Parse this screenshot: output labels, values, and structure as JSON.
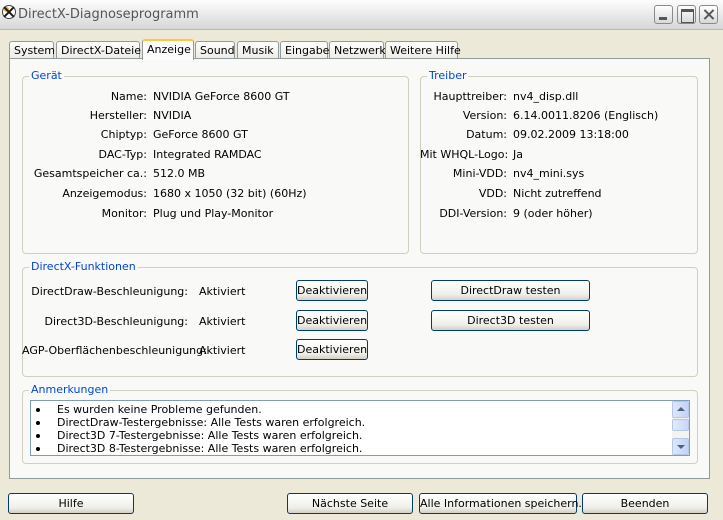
{
  "window": {
    "title": "DirectX-Diagnoseprogramm"
  },
  "tabs": [
    {
      "label": "System"
    },
    {
      "label": "DirectX-Dateien"
    },
    {
      "label": "Anzeige"
    },
    {
      "label": "Sound"
    },
    {
      "label": "Musik"
    },
    {
      "label": "Eingabe"
    },
    {
      "label": "Netzwerk"
    },
    {
      "label": "Weitere Hilfe"
    }
  ],
  "active_tab": "Anzeige",
  "device": {
    "title": "Gerät",
    "fields": [
      {
        "label": "Name:",
        "value": "NVIDIA GeForce 8600 GT"
      },
      {
        "label": "Hersteller:",
        "value": "NVIDIA"
      },
      {
        "label": "Chiptyp:",
        "value": "GeForce 8600 GT"
      },
      {
        "label": "DAC-Typ:",
        "value": "Integrated RAMDAC"
      },
      {
        "label": "Gesamtspeicher ca.:",
        "value": "512.0 MB"
      },
      {
        "label": "Anzeigemodus:",
        "value": "1680 x 1050 (32 bit) (60Hz)"
      },
      {
        "label": "Monitor:",
        "value": "Plug und Play-Monitor"
      }
    ]
  },
  "driver": {
    "title": "Treiber",
    "fields": [
      {
        "label": "Haupttreiber:",
        "value": "nv4_disp.dll"
      },
      {
        "label": "Version:",
        "value": "6.14.0011.8206 (Englisch)"
      },
      {
        "label": "Datum:",
        "value": "09.02.2009 13:18:00"
      },
      {
        "label": "Mit WHQL-Logo:",
        "value": "Ja"
      },
      {
        "label": "Mini-VDD:",
        "value": "nv4_mini.sys"
      },
      {
        "label": "VDD:",
        "value": "Nicht zutreffend"
      },
      {
        "label": "DDI-Version:",
        "value": "9 (oder höher)"
      }
    ]
  },
  "directx": {
    "title": "DirectX-Funktionen",
    "rows": [
      {
        "label": "DirectDraw-Beschleunigung:",
        "status": "Aktiviert",
        "toggle": "Deaktivieren",
        "test": "DirectDraw testen"
      },
      {
        "label": "Direct3D-Beschleunigung:",
        "status": "Aktiviert",
        "toggle": "Deaktivieren",
        "test": "Direct3D testen"
      },
      {
        "label": "AGP-Oberflächenbeschleunigung:",
        "status": "Aktiviert",
        "toggle": "Deaktivieren"
      }
    ]
  },
  "notes": {
    "title": "Anmerkungen",
    "items": [
      "Es wurden keine Probleme gefunden.",
      "DirectDraw-Testergebnisse: Alle Tests waren erfolgreich.",
      "Direct3D 7-Testergebnisse: Alle Tests waren erfolgreich.",
      "Direct3D 8-Testergebnisse: Alle Tests waren erfolgreich."
    ]
  },
  "footer": {
    "help": "Hilfe",
    "next_page": "Nächste Seite",
    "save_all": "Alle Informationen speichern...",
    "exit": "Beenden"
  }
}
